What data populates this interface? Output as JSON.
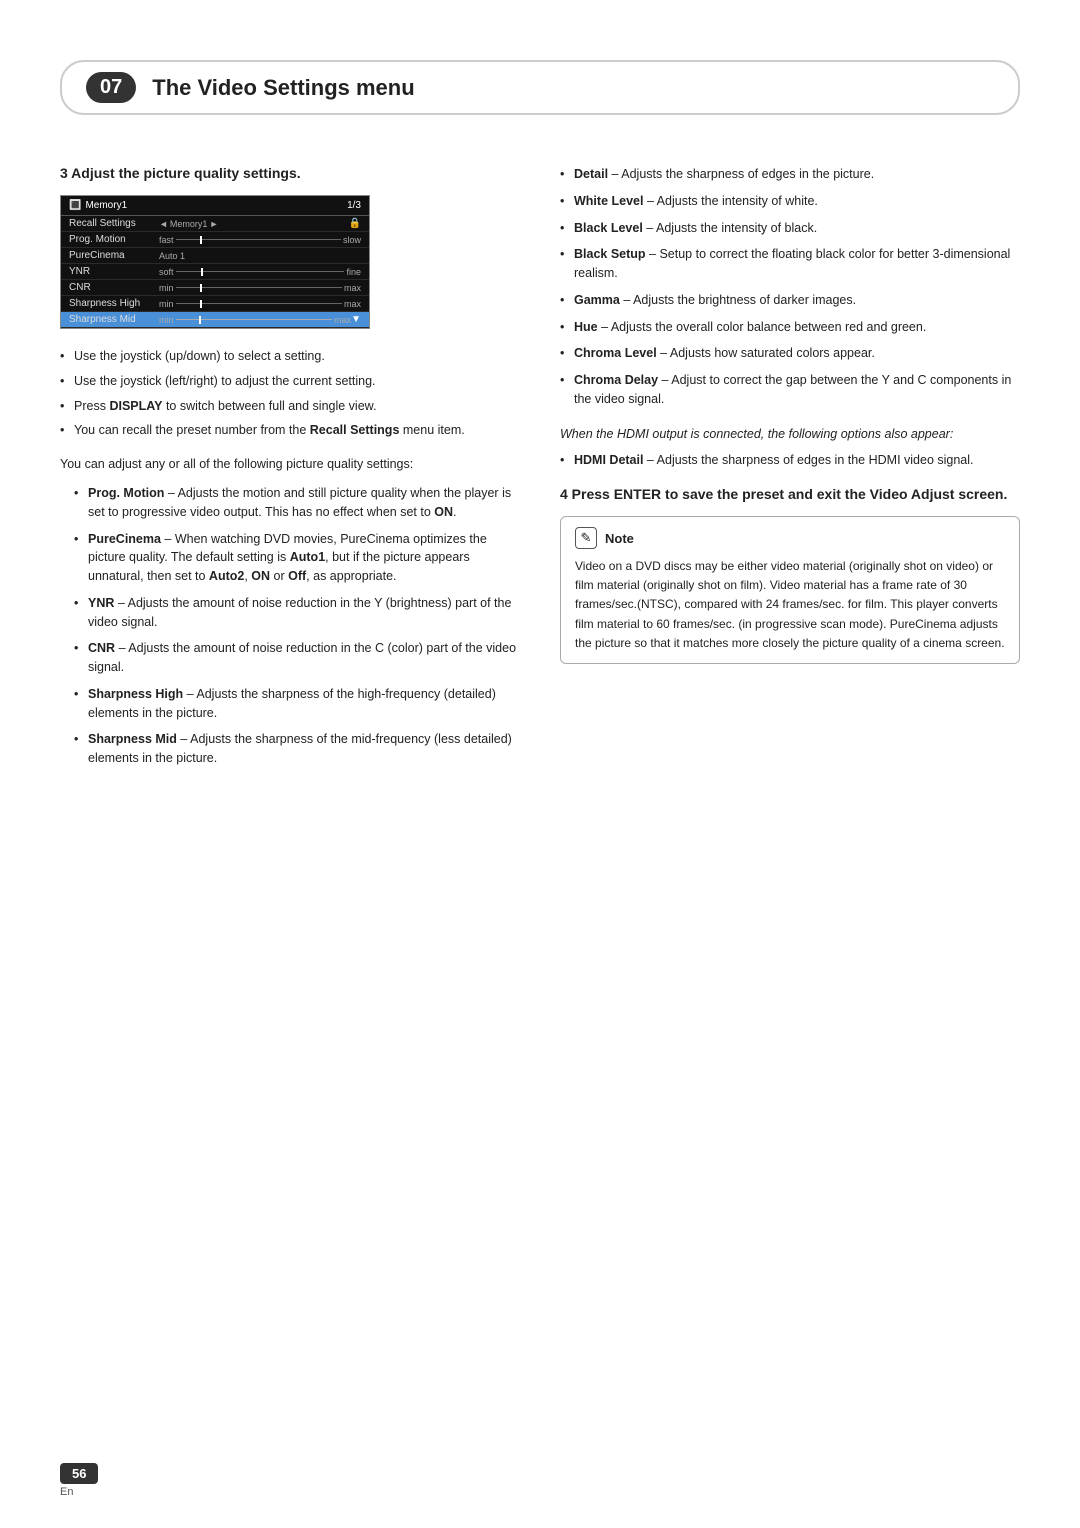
{
  "chapter": {
    "number": "07",
    "title": "The Video Settings menu"
  },
  "section3": {
    "heading": "3   Adjust the picture quality settings.",
    "screen": {
      "title": "Memory1",
      "page": "1/3",
      "rows": [
        {
          "label": "Recall Settings",
          "type": "nav",
          "value": "Memory1"
        },
        {
          "label": "Prog. Motion",
          "type": "bar",
          "prefix": "fast",
          "suffix": "slow",
          "markerPos": "10%"
        },
        {
          "label": "PureCinema",
          "type": "text",
          "value": "Auto 1"
        },
        {
          "label": "YNR",
          "type": "bar",
          "prefix": "soft",
          "suffix": "fine",
          "markerPos": "10%"
        },
        {
          "label": "CNR",
          "type": "bar",
          "prefix": "min",
          "suffix": "max",
          "markerPos": "10%"
        },
        {
          "label": "Sharpness High",
          "type": "bar",
          "prefix": "min",
          "suffix": "max",
          "markerPos": "10%"
        },
        {
          "label": "Sharpness Mid",
          "type": "bar",
          "prefix": "min",
          "suffix": "max",
          "markerPos": "10%",
          "selected": true
        }
      ]
    },
    "bullets": [
      "Use the joystick (up/down) to select a setting.",
      "Use the joystick (left/right) to adjust the current setting.",
      "Press <b>DISPLAY</b> to switch between full and single view.",
      "You can recall the preset number from the <b>Recall Settings</b> menu item."
    ],
    "intro": "You can adjust any or all of the following picture quality settings:",
    "nested_bullets": [
      {
        "term": "Prog. Motion",
        "desc": "– Adjusts the motion and still picture quality when the player is set to progressive video output. This has no effect when set to <b>ON</b>."
      },
      {
        "term": "PureCinema",
        "desc": "– When watching DVD movies, PureCinema optimizes the picture quality. The default setting is <b>Auto1</b>, but if the picture appears unnatural, then set to <b>Auto2</b>, <b>ON</b> or <b>Off</b>, as appropriate."
      },
      {
        "term": "YNR",
        "desc": "– Adjusts the amount of noise reduction in the Y (brightness) part of the video signal."
      },
      {
        "term": "CNR",
        "desc": "– Adjusts the amount of noise reduction in the C (color) part of the video signal."
      },
      {
        "term": "Sharpness High",
        "desc": "– Adjusts the sharpness of the high-frequency (detailed) elements in the picture."
      },
      {
        "term": "Sharpness Mid",
        "desc": "– Adjusts the sharpness of the mid-frequency (less detailed) elements in the picture."
      }
    ]
  },
  "section3_right": {
    "bullets": [
      {
        "term": "Detail",
        "desc": "– Adjusts the sharpness of edges in the picture."
      },
      {
        "term": "White Level",
        "desc": "– Adjusts the intensity of white."
      },
      {
        "term": "Black Level",
        "desc": "– Adjusts the intensity of black."
      },
      {
        "term": "Black Setup",
        "desc": "– Setup to correct the floating black color for better 3-dimensional realism."
      },
      {
        "term": "Gamma",
        "desc": "– Adjusts the brightness of darker images."
      },
      {
        "term": "Hue",
        "desc": "– Adjusts the overall color balance between red and green."
      },
      {
        "term": "Chroma Level",
        "desc": "– Adjusts how saturated colors appear."
      },
      {
        "term": "Chroma Delay",
        "desc": "– Adjust to correct the gap between the Y and C components in the video signal."
      }
    ],
    "hdmi_note": "When the HDMI output is connected, the following options also appear:",
    "hdmi_bullets": [
      {
        "term": "HDMI Detail",
        "desc": "– Adjusts the sharpness of edges in the HDMI video signal."
      }
    ]
  },
  "section4": {
    "heading": "4   Press ENTER to save the preset and exit the Video Adjust screen."
  },
  "note": {
    "label": "Note",
    "icon": "✎",
    "text": "Video on a DVD discs may be either video material (originally shot on video) or film material (originally shot on film). Video material has a frame rate of 30 frames/sec.(NTSC), compared with 24 frames/sec. for film. This player converts film material to 60 frames/sec. (in progressive scan mode). PureCinema adjusts the picture so that it matches more closely the picture quality of a cinema screen."
  },
  "footer": {
    "page_number": "56",
    "lang": "En"
  }
}
